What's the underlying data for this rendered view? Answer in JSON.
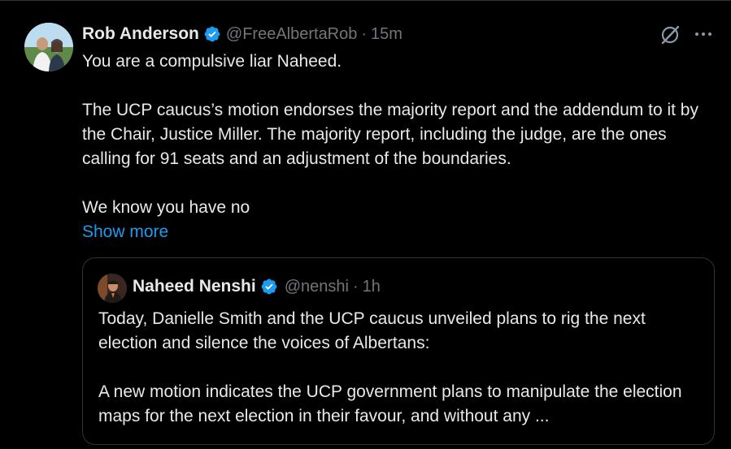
{
  "tweet": {
    "author": {
      "display_name": "Rob Anderson",
      "handle": "@FreeAlbertaRob",
      "time": "15m",
      "separator": "·"
    },
    "paragraphs": [
      "You are a compulsive liar Naheed.",
      "The UCP caucus’s motion endorses the majority report and the addendum to it by the Chair, Justice Miller. The majority report, including the judge, are the ones calling for 91 seats and an adjustment of the boundaries.",
      "We know you have no"
    ],
    "show_more_label": "Show more",
    "icons": {
      "verified": "verified-badge-icon",
      "grok": "grok-icon",
      "more": "more-options-icon"
    },
    "colors": {
      "accent": "#1d9bf0",
      "background": "#000000",
      "text": "#e7e9ea",
      "muted": "#71767b",
      "border": "#2f3336"
    }
  },
  "quoted_tweet": {
    "author": {
      "display_name": "Naheed Nenshi",
      "handle": "@nenshi",
      "time": "1h",
      "separator": "·"
    },
    "paragraphs": [
      "Today, Danielle Smith and the UCP caucus unveiled plans to rig the next election and silence the voices of Albertans:",
      "A new motion indicates the UCP government plans to manipulate the election maps for the next election in their favour, and without any ..."
    ]
  }
}
